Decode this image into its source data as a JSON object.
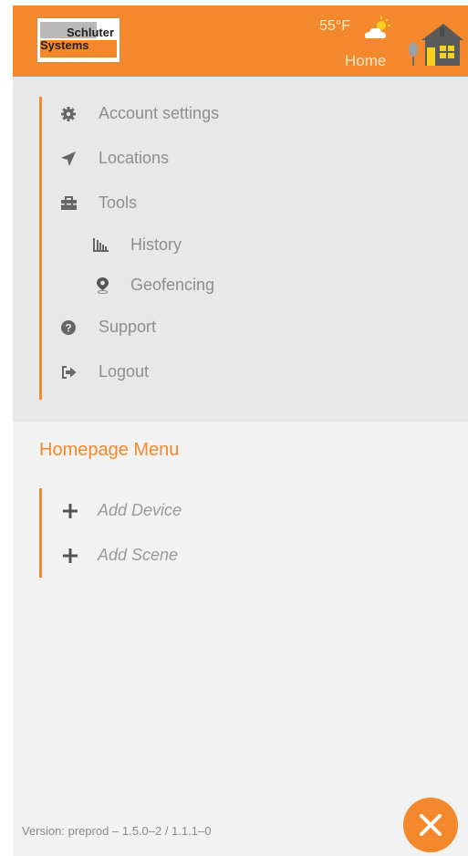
{
  "header": {
    "logo_line1": "Schluter",
    "logo_line2": "Systems",
    "temperature": "55°F",
    "weather_icon": "partly-cloudy-sun-icon",
    "location_label": "Home",
    "location_icon": "house-icon",
    "brand_color": "#f3892c"
  },
  "menu": {
    "items": [
      {
        "label": "Account settings",
        "icon": "gear-icon"
      },
      {
        "label": "Locations",
        "icon": "location-arrow-icon"
      },
      {
        "label": "Tools",
        "icon": "toolbox-icon"
      },
      {
        "label": "History",
        "icon": "bar-chart-icon"
      },
      {
        "label": "Geofencing",
        "icon": "map-pin-icon"
      },
      {
        "label": "Support",
        "icon": "question-circle-icon"
      },
      {
        "label": "Logout",
        "icon": "sign-out-icon"
      }
    ]
  },
  "homepage_menu": {
    "title": "Homepage Menu",
    "items": [
      {
        "label": "Add Device",
        "icon": "plus-icon"
      },
      {
        "label": "Add Scene",
        "icon": "plus-icon"
      }
    ]
  },
  "footer": {
    "version": "Version: preprod – 1.5.0–2 / 1.1.1–0",
    "close_icon": "close-icon"
  }
}
